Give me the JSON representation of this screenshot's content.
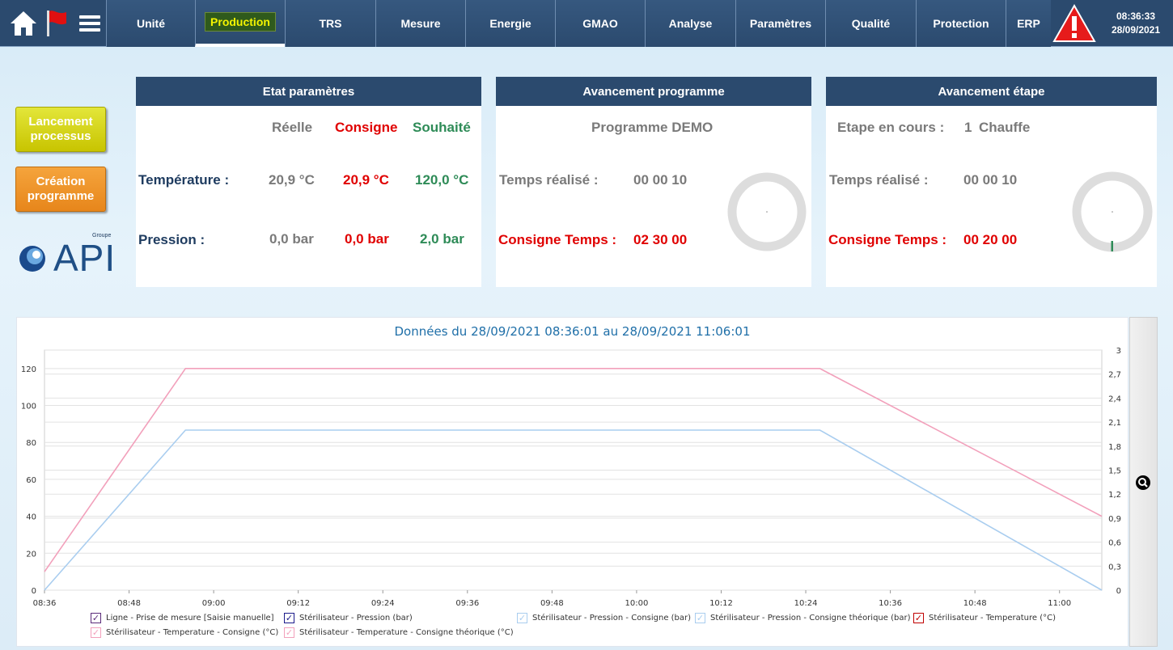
{
  "nav": {
    "tabs": [
      {
        "label": "Unité"
      },
      {
        "label": "Production"
      },
      {
        "label": "TRS"
      },
      {
        "label": "Mesure"
      },
      {
        "label": "Energie"
      },
      {
        "label": "GMAO"
      },
      {
        "label": "Analyse"
      },
      {
        "label": "Paramètres"
      },
      {
        "label": "Qualité"
      },
      {
        "label": "Protection"
      },
      {
        "label": "ERP"
      }
    ],
    "active_tab": "Production",
    "clock_time": "08:36:33",
    "clock_date": "28/09/2021",
    "icons": [
      "home-icon",
      "flag-icon",
      "menu-icon",
      "alarm-icon"
    ]
  },
  "side": {
    "launch_label_1": "Lancement",
    "launch_label_2": "processus",
    "create_label_1": "Création",
    "create_label_2": "programme",
    "logo_text": "API",
    "logo_small": "Groupe"
  },
  "etat": {
    "title": "Etat paramètres",
    "col_reelle": "Réelle",
    "col_consigne": "Consigne",
    "col_souhaite": "Souhaité",
    "row_temp": "Température :",
    "row_pression": "Pression :",
    "temp_reelle": "20,9 °C",
    "temp_consigne": "20,9 °C",
    "temp_souhaite": "120,0 °C",
    "pres_reelle": "0,0 bar",
    "pres_consigne": "0,0 bar",
    "pres_souhaite": "2,0 bar"
  },
  "programme": {
    "title": "Avancement programme",
    "name": "Programme DEMO",
    "temps_label": "Temps réalisé :",
    "temps_value": "00 00 10",
    "consigne_label": "Consigne Temps :",
    "consigne_value": "02 30 00"
  },
  "etape": {
    "title": "Avancement étape",
    "etape_label": "Etape en cours :",
    "etape_num": "1",
    "etape_name": "Chauffe",
    "temps_label": "Temps réalisé :",
    "temps_value": "00 00 10",
    "consigne_label": "Consigne Temps :",
    "consigne_value": "00 20 00"
  },
  "chart_data": {
    "type": "line",
    "title": "Données du 28/09/2021 08:36:01 au 28/09/2021 11:06:01",
    "x_ticks": [
      "08:36",
      "08:48",
      "09:00",
      "09:12",
      "09:24",
      "09:36",
      "09:48",
      "10:00",
      "10:12",
      "10:24",
      "10:36",
      "10:48",
      "11:00"
    ],
    "y_left_ticks": [
      "0",
      "20",
      "40",
      "60",
      "80",
      "100",
      "120"
    ],
    "y_right_ticks": [
      "0",
      "0,3",
      "0,6",
      "0,9",
      "1,2",
      "1,5",
      "1,8",
      "2,1",
      "2,4",
      "2,7",
      "3"
    ],
    "ylim_left": [
      0,
      130
    ],
    "ylim_right": [
      0,
      3
    ],
    "grid": true,
    "series": [
      {
        "name": "Stérilisateur - Temperature - Consigne théorique (°C)",
        "axis": "left",
        "color": "#f2a0bb",
        "points": [
          [
            "08:36",
            10
          ],
          [
            "08:56",
            120
          ],
          [
            "10:26",
            120
          ],
          [
            "11:06",
            40
          ]
        ]
      },
      {
        "name": "Stérilisateur - Pression - Consigne théorique (bar)",
        "axis": "right",
        "color": "#a9cdef",
        "points": [
          [
            "08:36",
            0
          ],
          [
            "08:56",
            2
          ],
          [
            "10:26",
            2
          ],
          [
            "11:06",
            0
          ]
        ]
      }
    ]
  },
  "legend": [
    {
      "label": "Ligne - Prise de mesure  [Saisie manuelle]",
      "color": "#5b2b7a"
    },
    {
      "label": "Stérilisateur - Pression (bar)",
      "color": "#1a1a8a"
    },
    {
      "label": "Stérilisateur - Pression - Consigne (bar)",
      "color": "#a9cdef"
    },
    {
      "label": "Stérilisateur - Pression - Consigne théorique (bar)",
      "color": "#a9cdef"
    },
    {
      "label": "Stérilisateur - Temperature (°C)",
      "color": "#c00000"
    },
    {
      "label": "Stérilisateur - Temperature - Consigne (°C)",
      "color": "#f2a0bb"
    },
    {
      "label": "Stérilisateur - Temperature - Consigne théorique (°C)",
      "color": "#f2a0bb"
    }
  ]
}
